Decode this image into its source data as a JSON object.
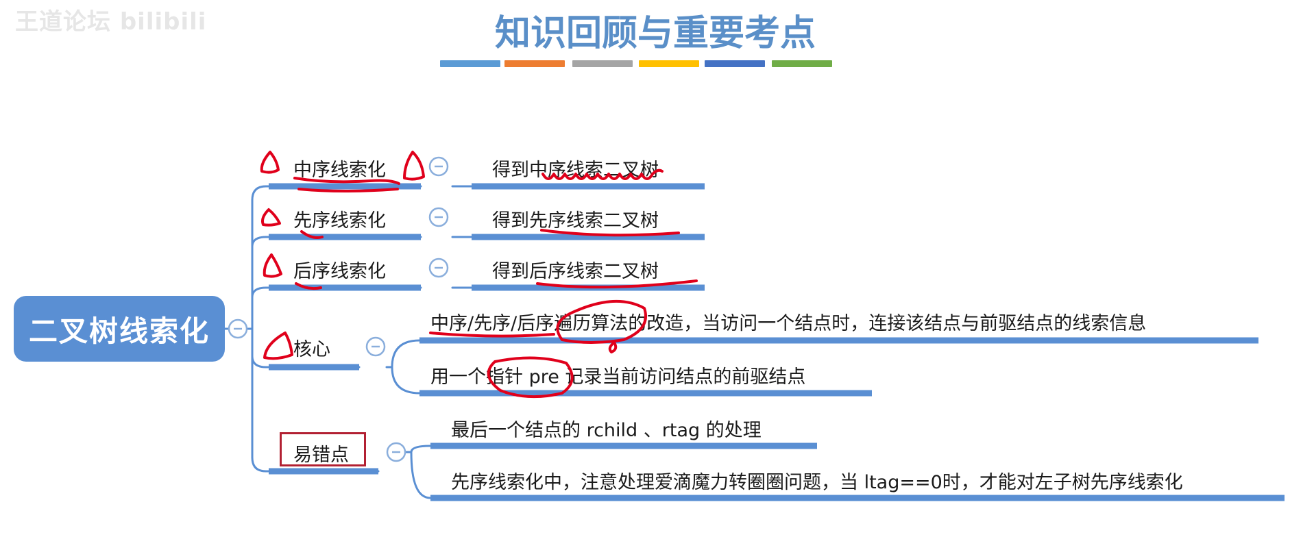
{
  "watermark": "王道论坛 bilibili",
  "title": "知识回顾与重要考点",
  "root": "二叉树线索化",
  "stripes": [
    "#5b9bd5",
    "#ed7d31",
    "#a5a5a5",
    "#ffc000",
    "#4472c4",
    "#70ad47"
  ],
  "colors": {
    "branch": "#5a8fd3",
    "annotation": "#e0001b",
    "root_bg": "#5a8fd3"
  },
  "branches": [
    {
      "label": "中序线索化",
      "result": "得到中序线索二叉树"
    },
    {
      "label": "先序线索化",
      "result": "得到先序线索二叉树"
    },
    {
      "label": "后序线索化",
      "result": "得到后序线索二叉树"
    },
    {
      "label": "核心",
      "items": [
        "中序/先序/后序遍历算法的改造，当访问一个结点时，连接该结点与前驱结点的线索信息",
        "用一个指针 pre 记录当前访问结点的前驱结点"
      ]
    },
    {
      "label": "易错点",
      "items": [
        "最后一个结点的 rchild 、rtag 的处理",
        "先序线索化中，注意处理爱滴魔力转圈圈问题，当 ltag==0时，才能对左子树先序线索化"
      ]
    }
  ]
}
